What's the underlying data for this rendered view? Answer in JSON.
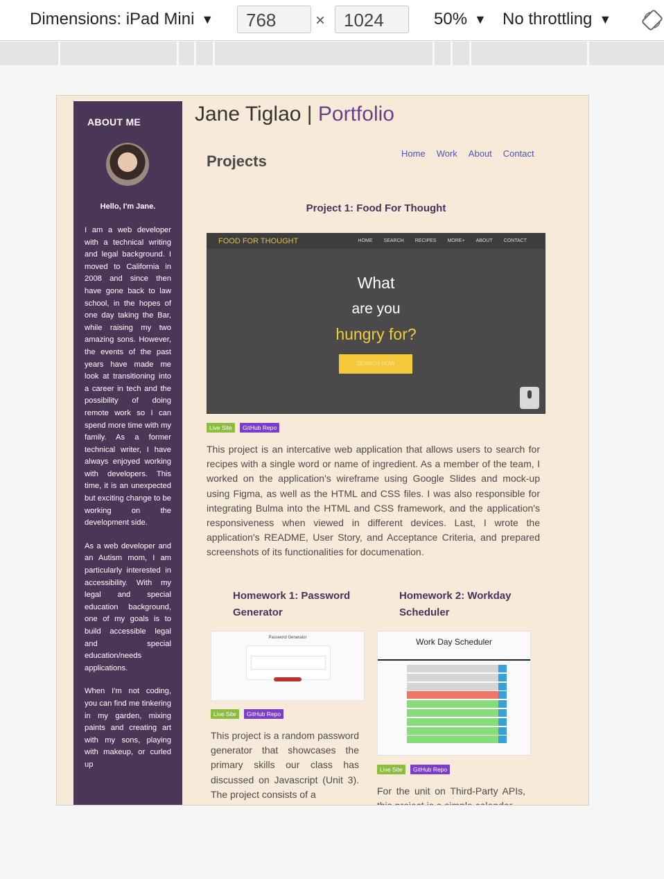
{
  "devtools": {
    "dimensions_label": "Dimensions: iPad Mini",
    "width": "768",
    "height": "1024",
    "times": "×",
    "zoom": "50%",
    "throttling": "No throttling",
    "dropdown_arrow": "▼"
  },
  "page": {
    "title_name": "Jane Tiglao | ",
    "title_accent": "Portfolio",
    "nav": [
      "Home",
      "Work",
      "About",
      "Contact"
    ],
    "section_heading": "Projects"
  },
  "sidebar": {
    "heading": "ABOUT ME",
    "greeting": "Hello, I'm Jane.",
    "paragraphs": [
      "I am a web developer with a technical writing and legal background. I moved to California in 2008 and since then have gone back to law school, in the hopes of one day taking the Bar, while raising my two amazing sons. However, the events of the past years have made me look at transitioning into a career in tech and the possibility of doing remote work so I can spend more time with my family. As a former technical writer, I have always enjoyed working with developers. This time, it is an unexpected but exciting change to be working on the development side.",
      "As a web developer and an Autism mom, I am particularly interested in accessibility. With my legal and special education background, one of my goals is to build accessible legal and special education/needs applications.",
      "When I'm not coding, you can find me tinkering in my garden, mixing paints and creating art with my sons, playing with makeup, or curled up"
    ]
  },
  "project1": {
    "title": "Project 1: Food For Thought",
    "screenshot": {
      "brand": "FOOD FOR THOUGHT",
      "nav": [
        "HOME",
        "SEARCH",
        "RECIPES",
        "MORE+",
        "ABOUT",
        "CONTACT"
      ],
      "line1": "What",
      "line2": "are you",
      "line3": "hungry for?",
      "button": "SEARCH NOW"
    },
    "live_label": "Live Site",
    "repo_label": "GitHub Repo",
    "description": "This project is an intercative web application that allows users to search for recipes with a single word or name of ingredient. As a member of the team, I worked on the application's wireframe using Google Slides and mock-up using Figma, as well as the HTML and CSS files. I was also responsible for integrating Bulma into the HTML and CSS framework, and the application's responsiveness when viewed in different devices. Last, I wrote the application's README, User Story, and Acceptance Criteria, and prepared screenshots of its functionalities for documenation."
  },
  "homework1": {
    "title": "Homework 1: Password Generator",
    "screenshot_heading": "Password Generator",
    "live_label": "Live Site",
    "repo_label": "GitHub Repo",
    "description": "This project is a random password generator that showcases the primary skills our class has discussed on Javascript (Unit 3). The project consists of a"
  },
  "homework2": {
    "title": "Homework 2: Workday Scheduler",
    "screenshot_heading": "Work Day Scheduler",
    "live_label": "Live Site",
    "repo_label": "GitHub Repo",
    "description": "For the unit on Third-Party APIs, this project is a simple calendar"
  },
  "colors": {
    "sidebar": "#4b3657",
    "page_bg": "#f7ead8",
    "accent": "#6a3e8a",
    "live_tag": "#8cbd3f",
    "repo_tag": "#7a3fc9",
    "nav_link": "#4a56b8"
  }
}
